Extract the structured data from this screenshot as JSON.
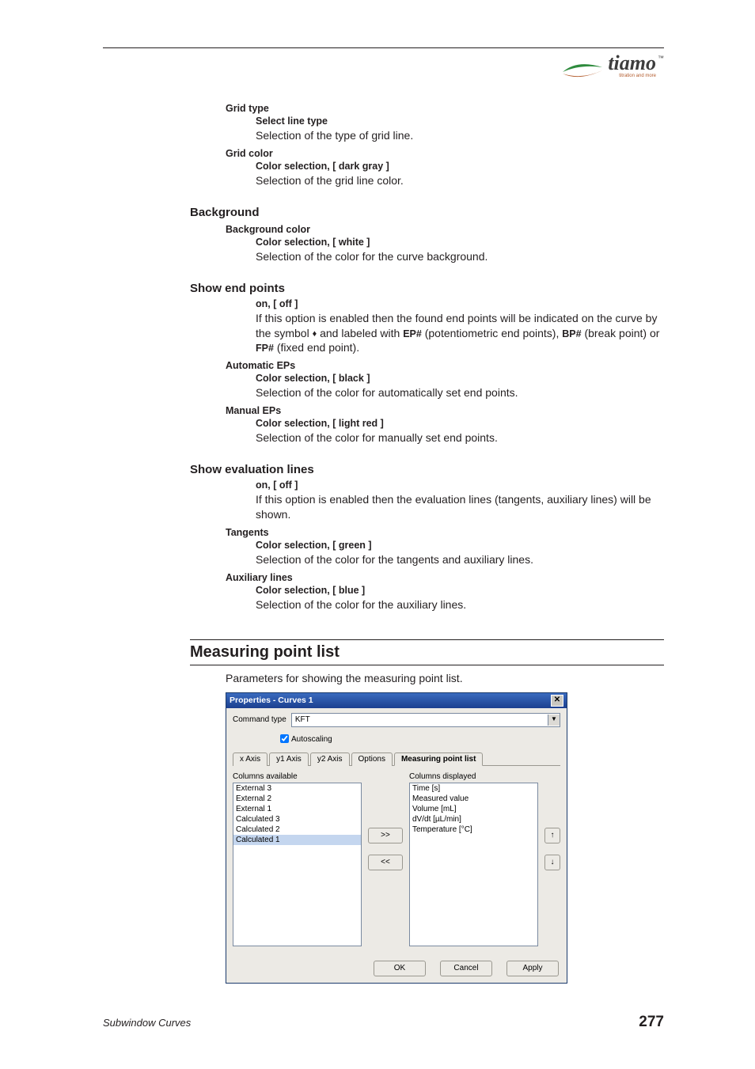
{
  "logo": {
    "text": "tiamo",
    "tag": "titration and more"
  },
  "gridType": {
    "label": "Grid type",
    "opt": "Select line type",
    "desc": "Selection of the type of grid line."
  },
  "gridColor": {
    "label": "Grid color",
    "opt": "Color selection, [ dark gray ]",
    "desc": "Selection of the grid line color."
  },
  "background": {
    "heading": "Background",
    "bgColor": {
      "label": "Background color",
      "opt": "Color selection, [ white ]",
      "desc": "Selection of the color for the curve background."
    }
  },
  "showEndPoints": {
    "heading": "Show end points",
    "opt": "on, [ off ]",
    "desc1": "If this option is enabled then the found end points will be indicated on the curve by the symbol ",
    "desc2": " and labeled with ",
    "ep": "EP#",
    "desc3": " (potentiometric end points), ",
    "bp": "BP#",
    "desc4": " (break point) or ",
    "fp": "FP#",
    "desc5": " (fixed end point).",
    "autoEPs": {
      "label": "Automatic EPs",
      "opt": "Color selection, [ black ]",
      "desc": "Selection of the color for automatically set end points."
    },
    "manualEPs": {
      "label": "Manual EPs",
      "opt": "Color selection, [ light red ]",
      "desc": "Selection of the color for manually set end points."
    }
  },
  "showEval": {
    "heading": "Show evaluation lines",
    "opt": "on, [ off ]",
    "desc": "If this option is enabled then the evaluation lines (tangents, auxiliary lines) will be shown.",
    "tangents": {
      "label": "Tangents",
      "opt": "Color selection, [ green ]",
      "desc": "Selection of the color for the tangents and auxiliary lines."
    },
    "aux": {
      "label": "Auxiliary lines",
      "opt": "Color selection, [ blue ]",
      "desc": "Selection of the color for the auxiliary lines."
    }
  },
  "mpl": {
    "heading": "Measuring point list",
    "intro": "Parameters for showing the measuring point list."
  },
  "dialog": {
    "title": "Properties - Curves 1",
    "cmdTypeLabel": "Command type",
    "cmdTypeValue": "KFT",
    "autoscaling": "Autoscaling",
    "tabs": {
      "xaxis": "x Axis",
      "y1axis": "y1 Axis",
      "y2axis": "y2 Axis",
      "options": "Options",
      "mpl": "Measuring point list"
    },
    "availLabel": "Columns available",
    "dispLabel": "Columns displayed",
    "avail": [
      "External 3",
      "External 2",
      "External 1",
      "Calculated 3",
      "Calculated 2",
      "Calculated 1"
    ],
    "disp": [
      "Time [s]",
      "Measured value",
      "Volume [mL]",
      "dV/dt [µL/min]",
      "Temperature [°C]"
    ],
    "addBtn": ">>",
    "remBtn": "<<",
    "upBtn": "↑",
    "dnBtn": "↓",
    "ok": "OK",
    "cancel": "Cancel",
    "apply": "Apply"
  },
  "footer": {
    "left": "Subwindow Curves",
    "right": "277"
  }
}
